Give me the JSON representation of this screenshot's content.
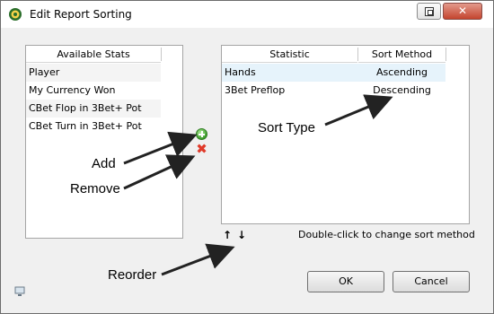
{
  "window": {
    "title": "Edit Report Sorting",
    "close_glyph": "✕"
  },
  "left_list": {
    "header": "Available Stats",
    "items": [
      "Player",
      "My Currency Won",
      "CBet Flop in 3Bet+ Pot",
      "CBet Turn in 3Bet+ Pot"
    ]
  },
  "right_list": {
    "headers": [
      "Statistic",
      "Sort Method"
    ],
    "rows": [
      {
        "statistic": "Hands",
        "sort_method": "Ascending"
      },
      {
        "statistic": "3Bet Preflop",
        "sort_method": "Descending"
      }
    ]
  },
  "controls": {
    "add_icon": "plus-circle",
    "remove_icon": "red-x",
    "remove_glyph": "✖",
    "up_glyph": "↑",
    "down_glyph": "↓",
    "hint": "Double-click to change sort method"
  },
  "buttons": {
    "ok": "OK",
    "cancel": "Cancel"
  },
  "annotations": {
    "sort_type": "Sort Type",
    "add": "Add",
    "remove": "Remove",
    "reorder": "Reorder"
  },
  "colors": {
    "selected_row": "#e6f3fb",
    "close_button": "#c4452e",
    "add_icon": "#3c9d2a",
    "remove_icon": "#e03a2a"
  }
}
